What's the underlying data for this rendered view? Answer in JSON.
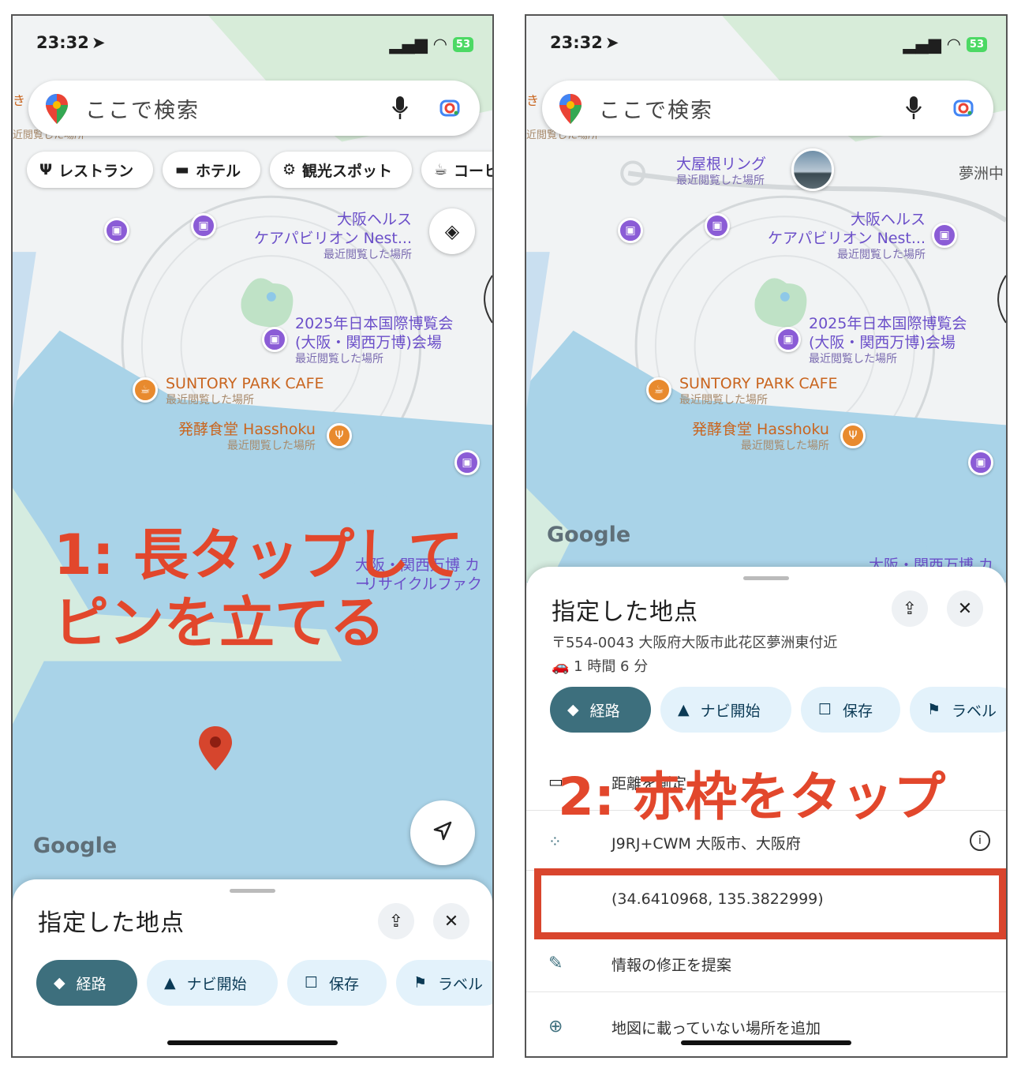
{
  "status": {
    "time": "23:32",
    "battery": "53"
  },
  "search": {
    "placeholder": "ここで検索"
  },
  "chips": [
    "レストラン",
    "ホテル",
    "観光スポット",
    "コーヒー"
  ],
  "map": {
    "edge_left_top": "き",
    "edge_left_sub": "近閲覧した場所",
    "poi_nest_line1": "大阪ヘルス",
    "poi_nest_line2": "ケアパビリオン Nest...",
    "recent": "最近閲覧した場所",
    "expo_line1": "2025年日本国際博覧会",
    "expo_line2": "(大阪・関西万博)会場",
    "cafe": "SUNTORY PARK CAFE",
    "hasshoku": "発酵食堂 Hasshoku",
    "expo_car": "大阪・関西万博 カー",
    "recycle": "リサイクルファク",
    "oyane_ring": "大屋根リング",
    "yumeshima": "夢洲中",
    "google": "Google"
  },
  "overlay1": {
    "line1": "1: 長タップして",
    "line2": "ピンを立てる"
  },
  "overlay2": {
    "text": "2: 赤枠をタップ"
  },
  "sheet": {
    "title": "指定した地点",
    "address": "〒554-0043 大阪府大阪市此花区夢洲東付近",
    "drive_time": "1 時間 6 分",
    "actions": [
      "経路",
      "ナビ開始",
      "保存",
      "ラベル"
    ],
    "measure": "距離を測定",
    "plus_code": "J9RJ+CWM 大阪市、大阪府",
    "coords": "(34.6410968, 135.3822999)",
    "suggest_edit": "情報の修正を提案",
    "add_place": "地図に載っていない場所を追加"
  },
  "colors": {
    "accent_red": "#e2472c",
    "primary_button": "#3d6f7d",
    "water": "#a9d3e8",
    "poi_purple": "#8b5cd6"
  }
}
